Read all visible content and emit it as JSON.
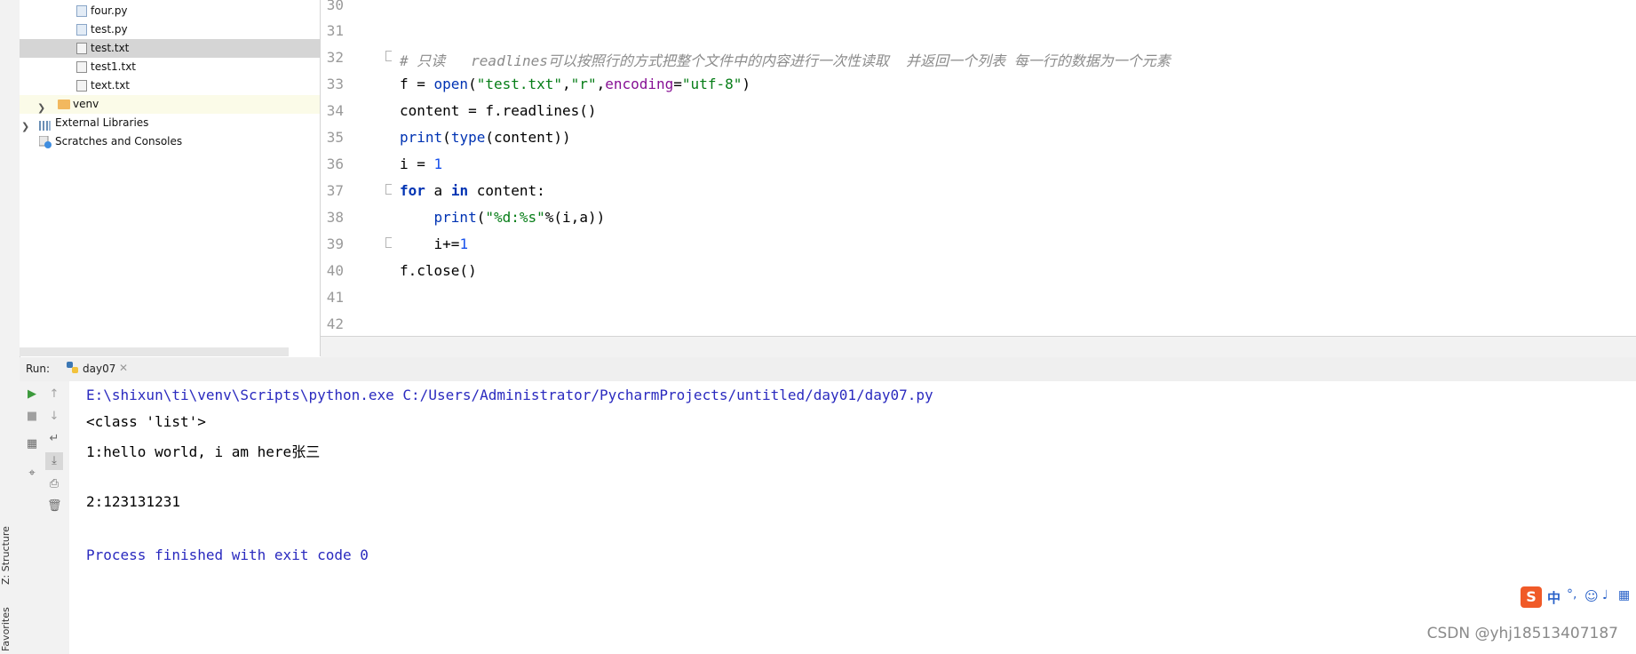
{
  "left_strip": {
    "structure_label": "Z: Structure",
    "favorites_label": "Favorites"
  },
  "tree": {
    "items": [
      {
        "label": "four.py",
        "icon": "python-file-icon"
      },
      {
        "label": "test.py",
        "icon": "python-file-icon"
      },
      {
        "label": "test.txt",
        "icon": "text-file-icon",
        "selected": true
      },
      {
        "label": "test1.txt",
        "icon": "text-file-icon"
      },
      {
        "label": "text.txt",
        "icon": "text-file-icon"
      },
      {
        "label": "venv",
        "icon": "folder-icon"
      },
      {
        "label": "External Libraries",
        "icon": "libraries-icon"
      },
      {
        "label": "Scratches and Consoles",
        "icon": "scratches-icon"
      }
    ]
  },
  "editor": {
    "line_numbers": [
      "30",
      "31",
      "32",
      "33",
      "34",
      "35",
      "36",
      "37",
      "38",
      "39",
      "40",
      "41",
      "42"
    ],
    "current_line": "36",
    "comment_line": "# 只读   readlines可以按照行的方式把整个文件中的内容进行一次性读取  并返回一个列表 每一行的数据为一个元素",
    "code": {
      "l33_a": "f = ",
      "l33_open": "open",
      "l33_b": "(",
      "l33_s1": "\"test.txt\"",
      "l33_c": ",",
      "l33_s2": "\"r\"",
      "l33_d": ",",
      "l33_enc": "encoding",
      "l33_e": "=",
      "l33_s3": "\"utf-8\"",
      "l33_f": ")",
      "l34": "content = f.readlines()",
      "l35_print": "print",
      "l35_a": "(",
      "l35_type": "type",
      "l35_b": "(content))",
      "l36_a": "i = ",
      "l36_num": "1",
      "l37_for": "for",
      "l37_a": " a ",
      "l37_in": "in",
      "l37_b": " content:",
      "l38_ind": "    ",
      "l38_print": "print",
      "l38_a": "(",
      "l38_s": "\"%d:%s\"",
      "l38_b": "%(i,a))",
      "l39_a": "    i+=",
      "l39_num": "1",
      "l40": "f.close()"
    }
  },
  "run": {
    "label": "Run:",
    "tab": "day07",
    "output": [
      "E:\\shixun\\ti\\venv\\Scripts\\python.exe C:/Users/Administrator/PycharmProjects/untitled/day01/day07.py",
      "<class 'list'>",
      "1:hello world, i am here张三",
      "",
      "2:123131231",
      "",
      "Process finished with exit code 0"
    ]
  },
  "ime": {
    "mode": "中",
    "punct": "°,"
  },
  "watermark": "CSDN @yhj18513407187",
  "colors": {
    "keyword": "#0033b3",
    "string": "#067d17",
    "param": "#871094",
    "number": "#1750eb",
    "comment": "#8c8c8c",
    "console_blue": "#2a2abf",
    "current_line": "#fffae3"
  }
}
